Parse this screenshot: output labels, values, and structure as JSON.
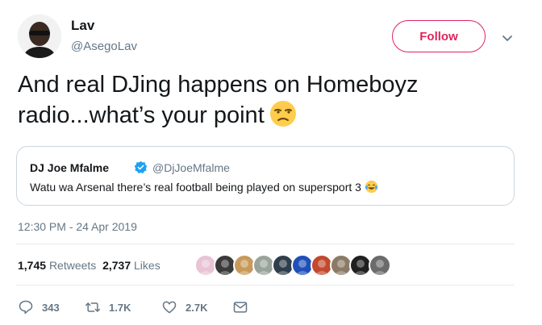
{
  "author": {
    "name": "Lav",
    "handle": "@AsegoLav",
    "avatar_icon": "profile-photo"
  },
  "follow": {
    "label": "Follow",
    "color": "#e0245e"
  },
  "tweet": {
    "text_line1": "And real DJing happens on Homeboyz",
    "text_line2": "radio...what’s your point",
    "emoji": "unamused-face-emoji"
  },
  "quoted": {
    "name": "DJ Joe Mfalme",
    "verified": true,
    "handle": "@DjJoeMfalme",
    "text": "Watu wa Arsenal there’s real football being played on supersport 3",
    "emoji": "tears-of-joy-emoji"
  },
  "timestamp": "12:30 PM - 24 Apr 2019",
  "stats": {
    "retweets_count": "1,745",
    "retweets_label": "Retweets",
    "likes_count": "2,737",
    "likes_label": "Likes"
  },
  "likers": [
    {
      "name": "liker-1",
      "color": "#e9c3d6"
    },
    {
      "name": "liker-2",
      "color": "#3a3a3a"
    },
    {
      "name": "liker-3",
      "color": "#c79a5b"
    },
    {
      "name": "liker-4",
      "color": "#9aa39a"
    },
    {
      "name": "liker-5",
      "color": "#2f3e4c"
    },
    {
      "name": "liker-6",
      "color": "#1f4fb8"
    },
    {
      "name": "liker-7",
      "color": "#c2492e"
    },
    {
      "name": "liker-8",
      "color": "#8a7a66"
    },
    {
      "name": "liker-9",
      "color": "#202020"
    },
    {
      "name": "liker-10",
      "color": "#6b6b6b"
    }
  ],
  "actions": {
    "reply_count": "343",
    "retweet_count": "1.7K",
    "like_count": "2.7K"
  },
  "colors": {
    "text": "#14171a",
    "secondary": "#657786",
    "border": "#ccd6dd",
    "verified": "#1da1f2"
  }
}
